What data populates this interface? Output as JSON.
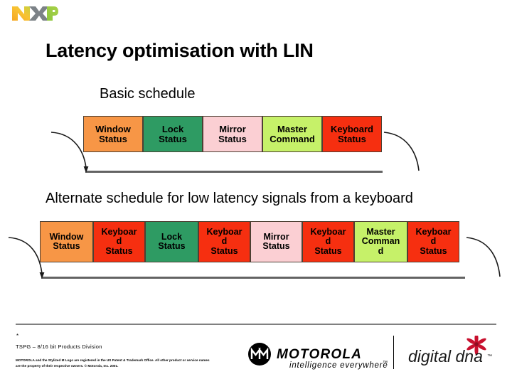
{
  "brand": {
    "nxp_logo_alt": "NXP",
    "motorola_wordmark": "MOTOROLA",
    "motorola_tagline": "intelligence everywhere",
    "digitaldna_wordmark": "digital dna"
  },
  "slide": {
    "title": "Latency optimisation with LIN",
    "basic_label": "Basic schedule",
    "alternate_label": "Alternate schedule for low latency signals from a keyboard"
  },
  "colors": {
    "window_status": "#F79646",
    "lock_status": "#2E9B63",
    "mirror_status": "#FBCFD3",
    "master_command": "#C6F169",
    "keyboard_status": "#F62F10",
    "cell_border": "#4D4033",
    "timeline": "#636363",
    "divider": "#808080",
    "nxp_orange": "#F5A623",
    "nxp_green": "#8CC63E",
    "nxp_gray": "#7C8287",
    "dna_red": "#C8102E"
  },
  "schedule_basic": {
    "name": "Basic schedule",
    "slots": [
      {
        "line1": "Window",
        "line2": "Status",
        "line3": "",
        "color": "#F79646",
        "width": 84
      },
      {
        "line1": "Lock",
        "line2": "Status",
        "line3": "",
        "color": "#2E9B63",
        "width": 84
      },
      {
        "line1": "Mirror",
        "line2": "Status",
        "line3": "",
        "color": "#FBCFD3",
        "width": 84
      },
      {
        "line1": "Master",
        "line2": "Command",
        "line3": "",
        "color": "#C6F169",
        "width": 84
      },
      {
        "line1": "Keyboard",
        "line2": "Status",
        "line3": "",
        "color": "#F62F10",
        "width": 84
      }
    ]
  },
  "schedule_alternate": {
    "name": "Alternate schedule for low latency signals from a keyboard",
    "slots": [
      {
        "line1": "Window",
        "line2": "Status",
        "line3": "",
        "color": "#F79646",
        "width": 75
      },
      {
        "line1": "Keyboar",
        "line2": "d",
        "line3": "Status",
        "color": "#F62F10",
        "width": 73
      },
      {
        "line1": "Lock",
        "line2": "Status",
        "line3": "",
        "color": "#2E9B63",
        "width": 75
      },
      {
        "line1": "Keyboar",
        "line2": "d",
        "line3": "Status",
        "color": "#F62F10",
        "width": 73
      },
      {
        "line1": "Mirror",
        "line2": "Status",
        "line3": "",
        "color": "#FBCFD3",
        "width": 73
      },
      {
        "line1": "Keyboar",
        "line2": "d",
        "line3": "Status",
        "color": "#F62F10",
        "width": 73
      },
      {
        "line1": "Master",
        "line2": "Comman",
        "line3": "d",
        "color": "#C6F169",
        "width": 75
      },
      {
        "line1": "Keyboar",
        "line2": "d",
        "line3": "Status",
        "color": "#F62F10",
        "width": 73
      }
    ]
  },
  "footer": {
    "asterisk": "*",
    "division": "TSPG – 8/16 bit Products Division",
    "legal": "MOTOROLA and the Stylized M Logo are registered in the US Patent & Trademark Office. All other product or service names are the property of their respective owners.  © Motorola, Inc. 2001."
  }
}
